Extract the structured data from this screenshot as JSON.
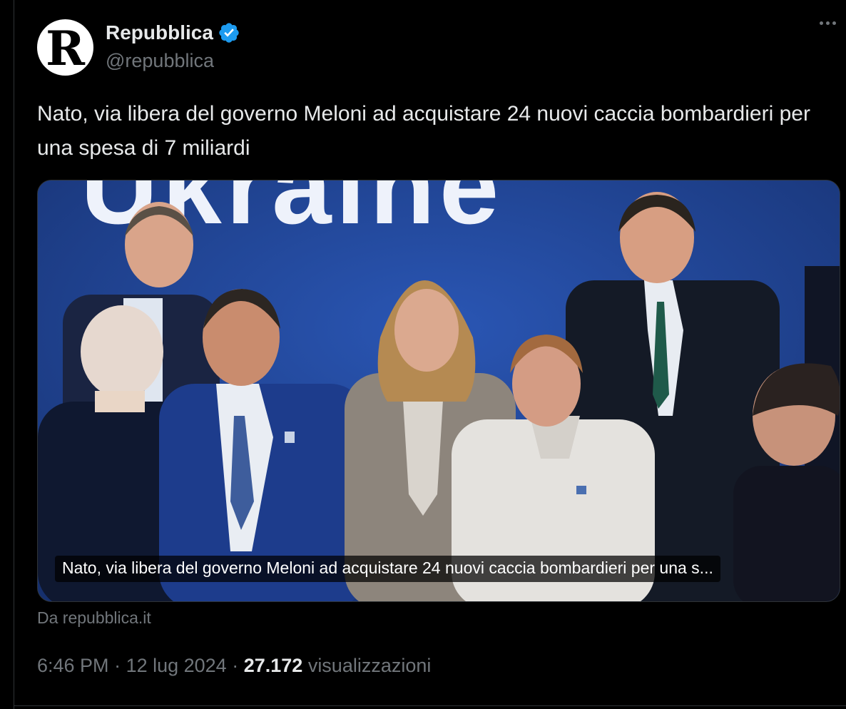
{
  "author": {
    "avatar_letter": "R",
    "display_name": "Repubblica",
    "handle": "@repubblica",
    "verified_icon": "verified-badge-icon"
  },
  "tweet": {
    "text": "Nato, via libera del governo Meloni ad acquistare 24 nuovi caccia bombardieri per una spesa di 7 miliardi"
  },
  "media": {
    "banner_text": "Ukraine",
    "caption": "Nato, via libera del governo Meloni ad acquistare 24 nuovi caccia bombardieri per una s..."
  },
  "source": "Da repubblica.it",
  "meta": {
    "time": "6:46 PM",
    "separator": " · ",
    "date": "12 lug 2024",
    "views_count": "27.172",
    "views_label": "visualizzazioni"
  },
  "colors": {
    "background": "#000000",
    "text_primary": "#e7e9ea",
    "text_secondary": "#71767b",
    "border": "#2f3336",
    "verified_blue": "#1d9bf0",
    "photo_backdrop": "#1e3f8f"
  }
}
